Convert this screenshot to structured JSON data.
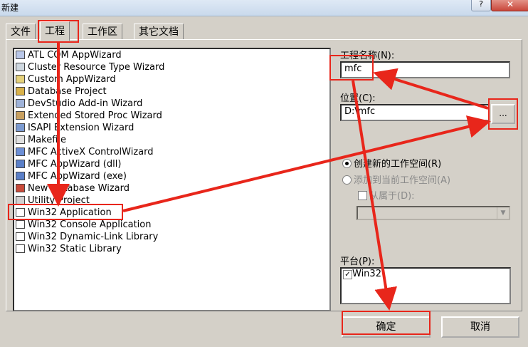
{
  "window": {
    "title": "新建",
    "help_label": "?",
    "close_label": "✕"
  },
  "tabs": [
    {
      "label": "文件",
      "active": false
    },
    {
      "label": "工程",
      "active": true
    },
    {
      "label": "工作区",
      "active": false
    },
    {
      "label": "其它文档",
      "active": false
    }
  ],
  "project_types": [
    {
      "label": "ATL COM AppWizard",
      "icon": "atl-wizard-icon"
    },
    {
      "label": "Cluster Resource Type Wizard",
      "icon": "cluster-wizard-icon"
    },
    {
      "label": "Custom AppWizard",
      "icon": "custom-wizard-icon"
    },
    {
      "label": "Database Project",
      "icon": "database-icon"
    },
    {
      "label": "DevStudio Add-in Wizard",
      "icon": "addin-wizard-icon"
    },
    {
      "label": "Extended Stored Proc Wizard",
      "icon": "stored-proc-icon"
    },
    {
      "label": "ISAPI Extension Wizard",
      "icon": "isapi-icon"
    },
    {
      "label": "Makefile",
      "icon": "makefile-icon"
    },
    {
      "label": "MFC ActiveX ControlWizard",
      "icon": "activex-icon"
    },
    {
      "label": "MFC AppWizard (dll)",
      "icon": "mfc-dll-icon"
    },
    {
      "label": "MFC AppWizard (exe)",
      "icon": "mfc-exe-icon"
    },
    {
      "label": "New Database Wizard",
      "icon": "new-database-icon"
    },
    {
      "label": "Utility Project",
      "icon": "utility-icon"
    },
    {
      "label": "Win32 Application",
      "icon": "win32-app-icon"
    },
    {
      "label": "Win32 Console Application",
      "icon": "console-app-icon"
    },
    {
      "label": "Win32 Dynamic-Link Library",
      "icon": "dll-icon"
    },
    {
      "label": "Win32 Static Library",
      "icon": "static-lib-icon"
    }
  ],
  "project_name": {
    "label": "工程名称(N):",
    "value": "mfc"
  },
  "location": {
    "label": "位置(C):",
    "value": "D:\\mfc",
    "browse_label": "..."
  },
  "workspace": {
    "create_new_label": "创建新的工作空间(R)",
    "add_to_current_label": "添加到当前工作空间(A)",
    "dependency_label": "从属于(D):",
    "dependency_value": ""
  },
  "platform": {
    "label": "平台(P):",
    "item": "Win32",
    "checked": true
  },
  "buttons": {
    "ok": "确定",
    "cancel": "取消"
  },
  "colors": {
    "annotation_red": "#e8261b",
    "dialog_face": "#d4d0c8"
  }
}
